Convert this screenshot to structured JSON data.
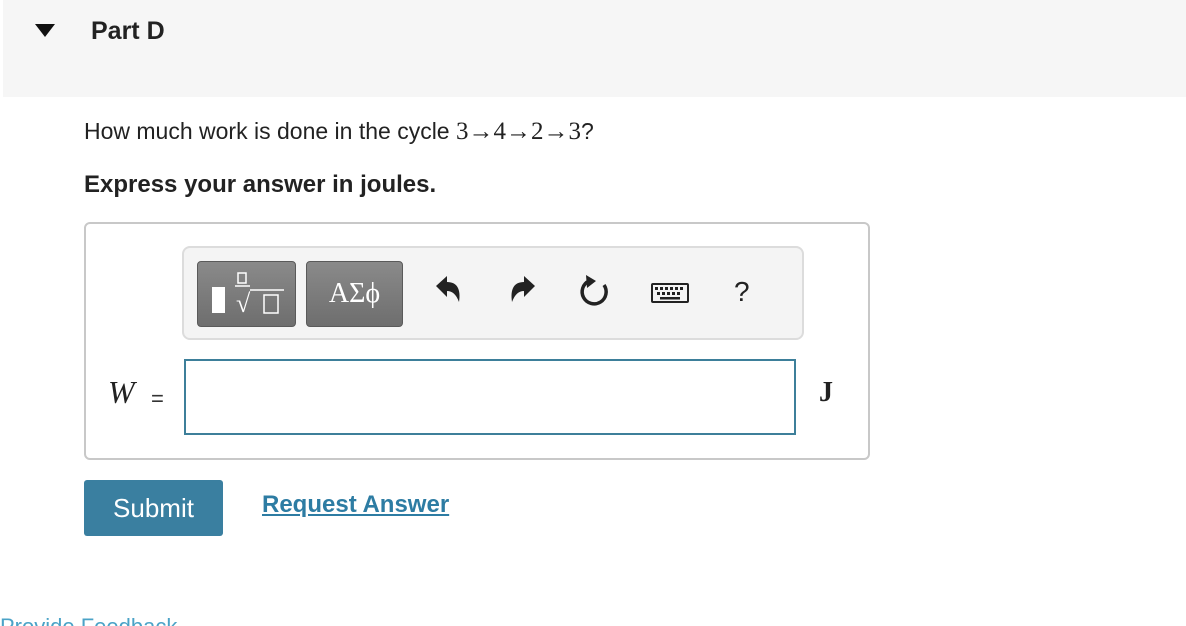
{
  "part": {
    "title": "Part D"
  },
  "question": {
    "prefix": "How much work is done in the cycle ",
    "math": "3→4→2→3",
    "suffix": "?"
  },
  "instruction": "Express your answer in joules.",
  "toolbar": {
    "symbols_label": "ΑΣϕ",
    "help_label": "?"
  },
  "answer": {
    "variable": "W",
    "equals": "=",
    "value": "",
    "unit": "J"
  },
  "actions": {
    "submit_label": "Submit",
    "request_label": "Request Answer"
  },
  "footer": {
    "partial_link": "Provide Feedback"
  }
}
